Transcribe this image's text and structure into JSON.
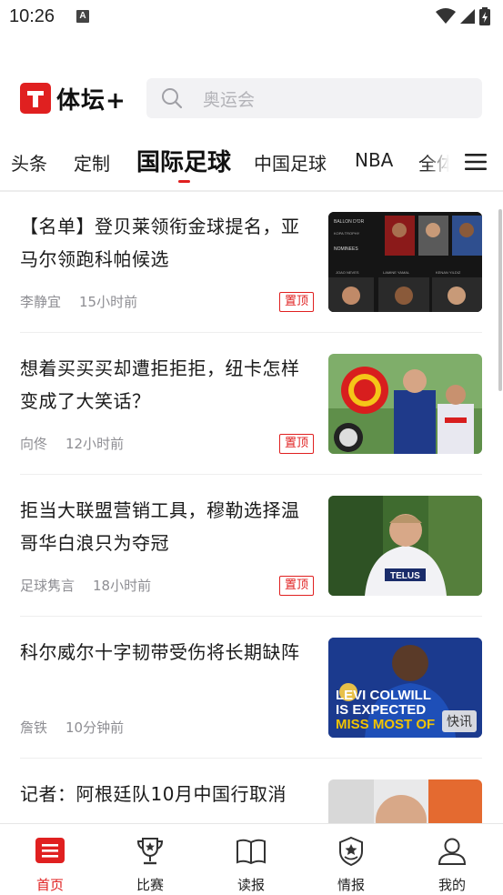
{
  "status_bar": {
    "time": "10:26",
    "notification_icon": "A"
  },
  "header": {
    "logo_text": "体坛+",
    "search_placeholder": "奥运会"
  },
  "tabs": [
    {
      "label": "头条"
    },
    {
      "label": "定制"
    },
    {
      "label": "国际足球",
      "active": true
    },
    {
      "label": "中国足球"
    },
    {
      "label": "NBA"
    },
    {
      "label": "全体"
    }
  ],
  "articles": [
    {
      "title": "【名单】登贝莱领衔金球提名，亚马尔领跑科帕候选",
      "author": "李静宜",
      "time": "15小时前",
      "badge": "置顶",
      "thumb_labels": [
        "BALLON D'OR",
        "KOPA TROPHY",
        "NOMINEES",
        "JOAO NEVES",
        "LAMINE YAMAL",
        "KENAN YILDIZ"
      ]
    },
    {
      "title": "想着买买买却遭拒拒拒，纽卡怎样变成了大笑话？",
      "author": "向佟",
      "time": "12小时前",
      "badge": "置顶"
    },
    {
      "title": "拒当大联盟营销工具，穆勒选择温哥华白浪只为夺冠",
      "author": "足球隽言",
      "time": "18小时前",
      "badge": "置顶",
      "thumb_labels": [
        "TELUS"
      ]
    },
    {
      "title": "科尔威尔十字韧带受伤将长期缺阵",
      "author": "詹铁",
      "time": "10分钟前",
      "badge": "快讯",
      "thumb_labels": [
        "LEVI COLWILL",
        "IS EXPECTED",
        "MISS MOST OF"
      ]
    },
    {
      "title": "记者：阿根廷队10月中国行取消",
      "author": "",
      "time": ""
    }
  ],
  "bottom_nav": [
    {
      "label": "首页",
      "icon": "home-icon",
      "active": true
    },
    {
      "label": "比赛",
      "icon": "trophy-icon"
    },
    {
      "label": "读报",
      "icon": "book-icon"
    },
    {
      "label": "情报",
      "icon": "badge-star-icon"
    },
    {
      "label": "我的",
      "icon": "profile-icon"
    }
  ],
  "colors": {
    "accent": "#e02020",
    "meta": "#8e8e93"
  }
}
